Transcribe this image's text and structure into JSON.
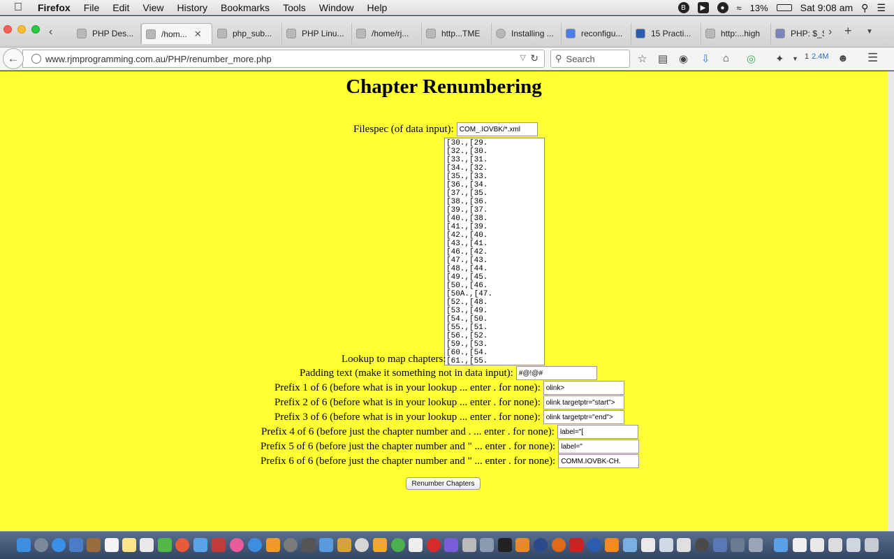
{
  "menubar": {
    "app": "Firefox",
    "items": [
      "File",
      "Edit",
      "View",
      "History",
      "Bookmarks",
      "Tools",
      "Window",
      "Help"
    ],
    "battery": "13%",
    "clock": "Sat 9:08 am"
  },
  "tabs": [
    {
      "label": "PHP Des..."
    },
    {
      "label": "/hom..."
    },
    {
      "label": "php_sub..."
    },
    {
      "label": "PHP Linu..."
    },
    {
      "label": "/home/rj..."
    },
    {
      "label": "http...TME"
    },
    {
      "label": "Installing ..."
    },
    {
      "label": "reconfigu..."
    },
    {
      "label": "15 Practi..."
    },
    {
      "label": "http:...high"
    },
    {
      "label": "PHP: $_S"
    }
  ],
  "navbar": {
    "url": "www.rjmprogramming.com.au/PHP/renumber_more.php",
    "search_placeholder": "Search",
    "downloads_count": "1",
    "downloads_size": "2.4M"
  },
  "page": {
    "title": "Chapter Renumbering",
    "filespec_label": "Filespec (of data input):",
    "filespec_value": "COM_.IOVBK/*.xml",
    "lookup_label": "Lookup to map chapters:",
    "lookup_value": "[30.,[29.\n[32.,[30.\n[33.,[31.\n[34.,[32.\n[35.,[33.\n[36.,[34.\n[37.,[35.\n[38.,[36.\n[39.,[37.\n[40.,[38.\n[41.,[39.\n[42.,[40.\n[43.,[41.\n[46.,[42.\n[47.,[43.\n[48.,[44.\n[49.,[45.\n[50.,[46.\n[50A.,[47.\n[52.,[48.\n[53.,[49.\n[54.,[50.\n[55.,[51.\n[56.,[52.\n[59.,[53.\n[60.,[54.\n[61.,[55.",
    "padding_label": "Padding text (make it something not in data input):",
    "padding_value": "#@!@#",
    "prefixes": [
      {
        "label": "Prefix 1 of 6 (before what is in your lookup ... enter . for none):",
        "value": "olink>"
      },
      {
        "label": "Prefix 2 of 6 (before what is in your lookup ... enter . for none):",
        "value": "olink targetptr=\"start\">"
      },
      {
        "label": "Prefix 3 of 6 (before what is in your lookup ... enter . for none):",
        "value": "olink targetptr=\"end\">"
      },
      {
        "label": "Prefix 4 of 6 (before just the chapter number and . ... enter . for none):",
        "value": "label=\"["
      },
      {
        "label": "Prefix 5 of 6 (before just the chapter number and \" ... enter . for none):",
        "value": "label=\""
      },
      {
        "label": "Prefix 6 of 6 (before just the chapter number and \" ... enter . for none):",
        "value": "COMM.IOVBK-CH."
      }
    ],
    "submit_label": "Renumber Chapters",
    "background_color": "#ffff33"
  }
}
